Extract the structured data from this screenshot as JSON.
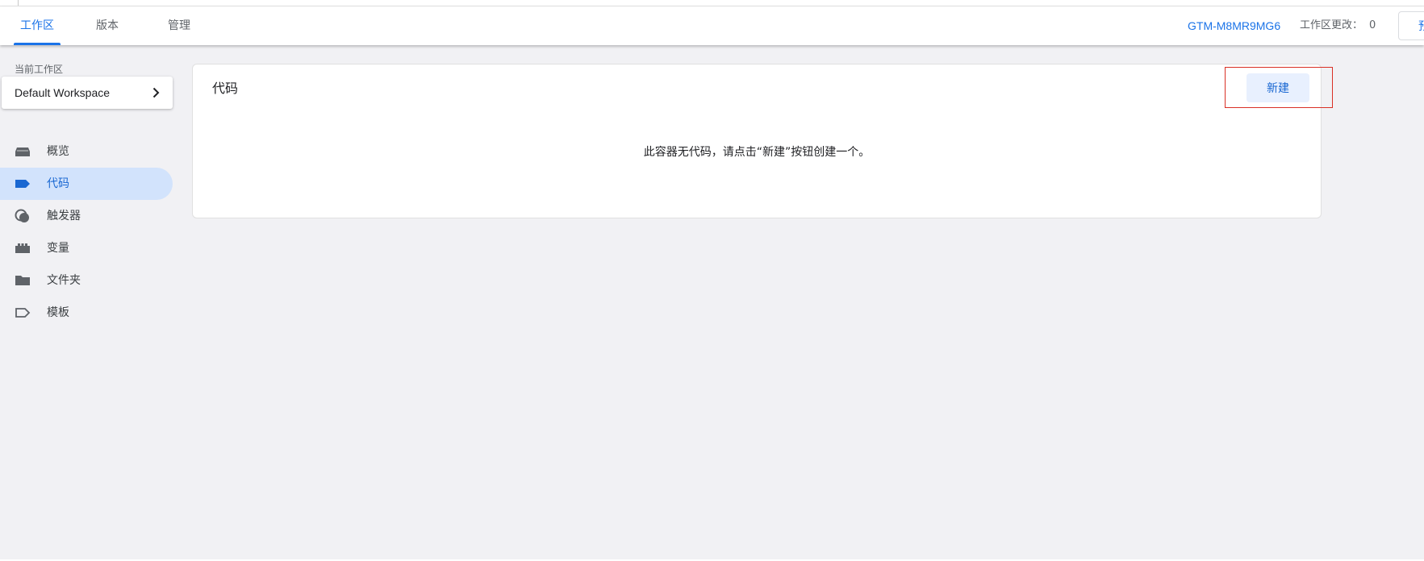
{
  "header": {
    "tabs": [
      {
        "label": "工作区",
        "active": true
      },
      {
        "label": "版本",
        "active": false
      },
      {
        "label": "管理",
        "active": false
      }
    ],
    "container_id": "GTM-M8MR9MG6",
    "workspace_changes_label": "工作区更改：",
    "workspace_changes_count": "0",
    "preview_label": "预览"
  },
  "sidebar": {
    "current_workspace_label": "当前工作区",
    "workspace_name": "Default Workspace",
    "items": [
      {
        "label": "概览",
        "icon": "overview-icon",
        "active": false
      },
      {
        "label": "代码",
        "icon": "tag-icon",
        "active": true
      },
      {
        "label": "触发器",
        "icon": "trigger-icon",
        "active": false
      },
      {
        "label": "变量",
        "icon": "variable-icon",
        "active": false
      },
      {
        "label": "文件夹",
        "icon": "folder-icon",
        "active": false
      },
      {
        "label": "模板",
        "icon": "template-icon",
        "active": false
      }
    ]
  },
  "main": {
    "card_title": "代码",
    "new_button_label": "新建",
    "empty_message": "此容器无代码，请点击“新建”按钮创建一个。"
  },
  "colors": {
    "accent": "#1a73e8",
    "active_nav_bg": "#d2e3fc",
    "new_button_bg": "#e8f0fe",
    "highlight_border": "#d93025",
    "page_bg": "#f1f1f4"
  }
}
